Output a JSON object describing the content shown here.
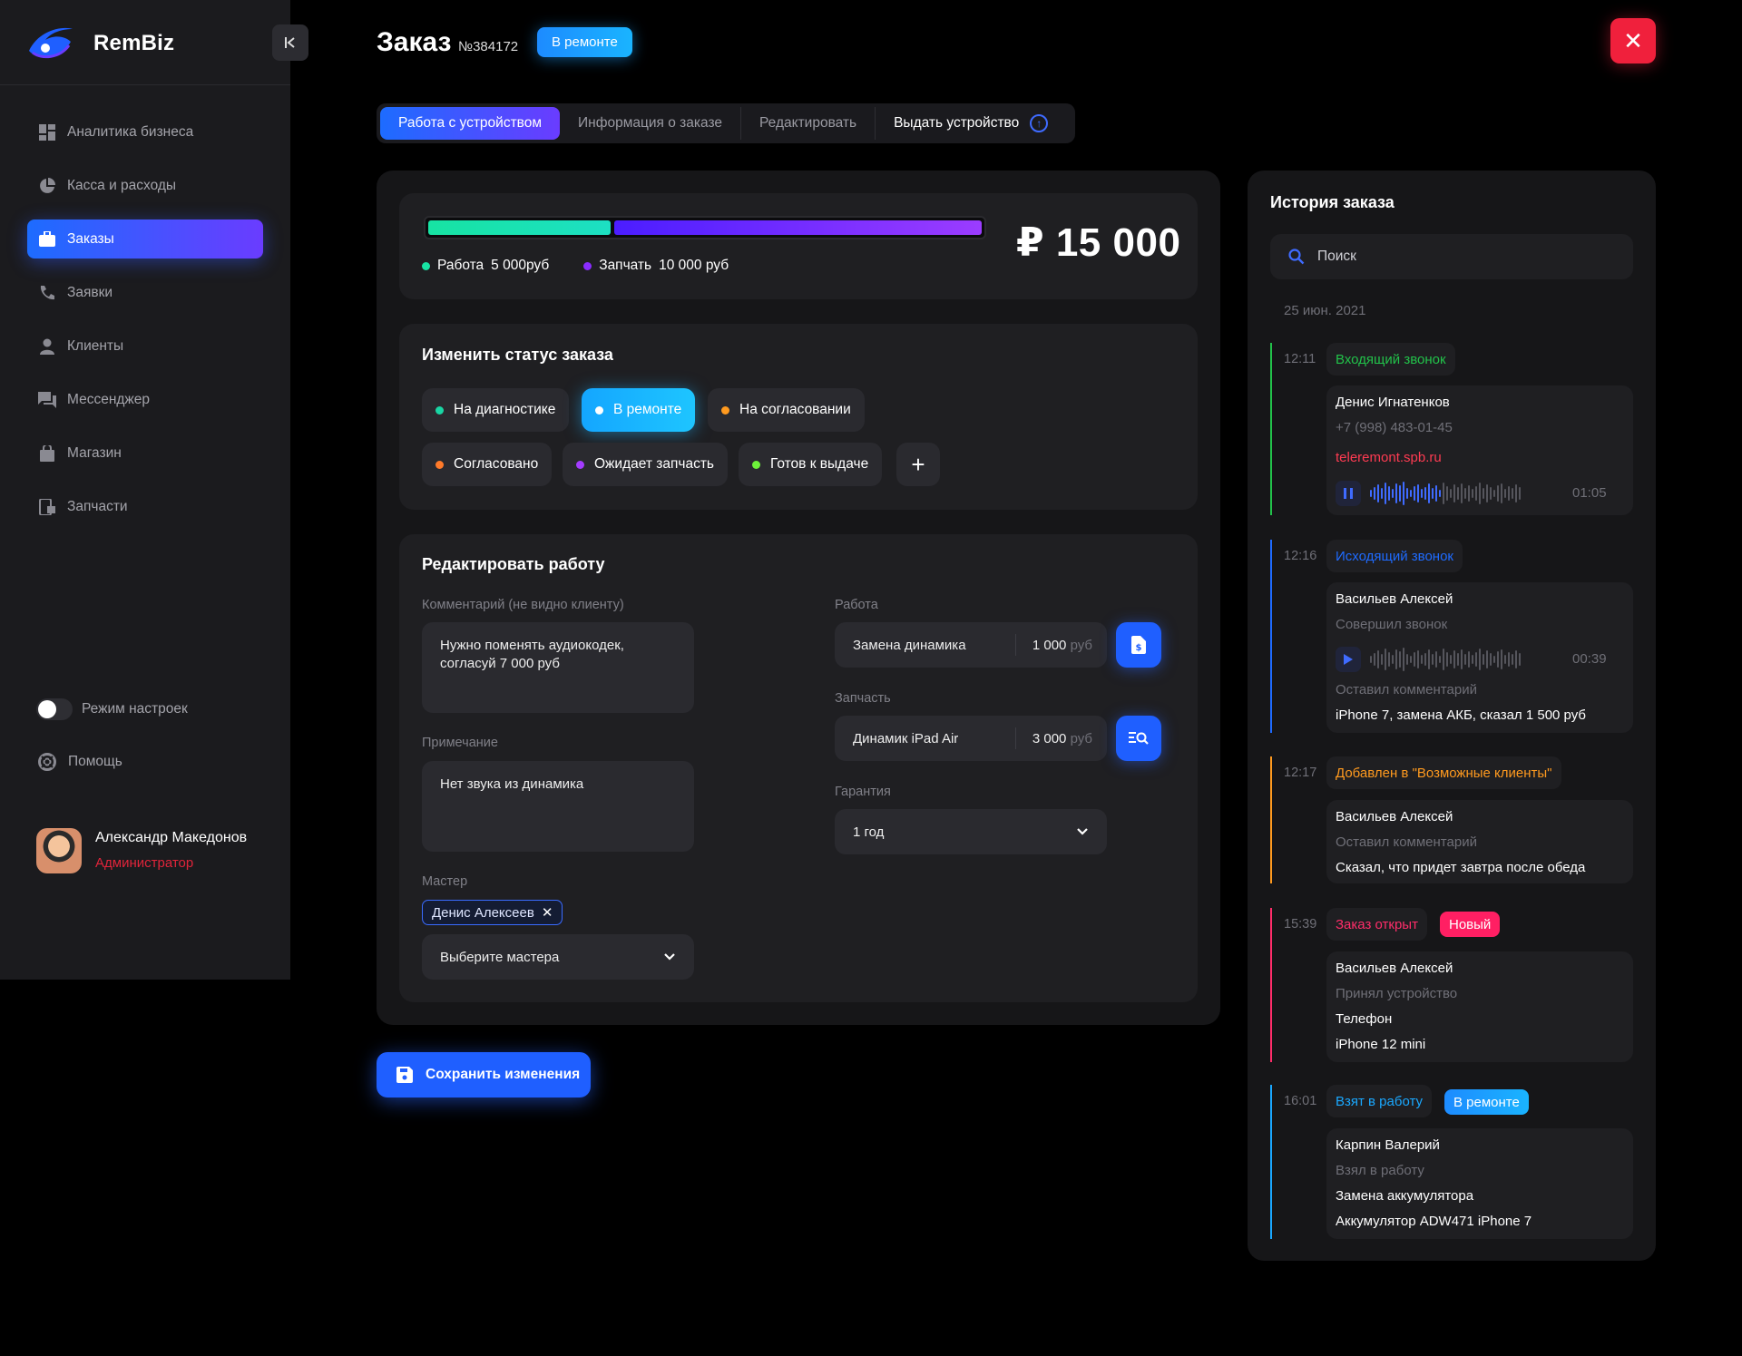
{
  "app": {
    "name": "RemBiz"
  },
  "sidebar": {
    "items": [
      {
        "label": "Аналитика бизнеса",
        "icon": "dashboard-icon",
        "active": false
      },
      {
        "label": "Касса и расходы",
        "icon": "pie-chart-icon",
        "active": false
      },
      {
        "label": "Заказы",
        "icon": "briefcase-icon",
        "active": true
      },
      {
        "label": "Заявки",
        "icon": "phone-icon",
        "active": false
      },
      {
        "label": "Клиенты",
        "icon": "user-icon",
        "active": false
      },
      {
        "label": "Мессенджер",
        "icon": "chat-icon",
        "active": false
      },
      {
        "label": "Магазин",
        "icon": "shopping-bag-icon",
        "active": false
      },
      {
        "label": "Запчасти",
        "icon": "parts-icon",
        "active": false
      }
    ],
    "settings_mode": "Режим настроек",
    "help": "Помощь",
    "user": {
      "name": "Александр Македонов",
      "role": "Администратор"
    }
  },
  "header": {
    "title": "Заказ",
    "number": "№384172",
    "status": "В ремонте"
  },
  "tabs": [
    {
      "label": "Работа с устройством",
      "active": true
    },
    {
      "label": "Информация о заказе",
      "active": false
    },
    {
      "label": "Редактировать",
      "active": false
    },
    {
      "label": "Выдать устройство",
      "active": false
    }
  ],
  "cost": {
    "work_fraction": 0.33,
    "part_fraction": 0.67,
    "work_label": "Работа",
    "work_value": "5 000руб",
    "part_label": "Запчать",
    "part_value": "10 000 руб",
    "total": "₽ 15 000"
  },
  "status_change": {
    "title": "Изменить статус заказа",
    "options": [
      {
        "label": "На диагностике",
        "color": "#19d6a4",
        "active": false
      },
      {
        "label": "В ремонте",
        "color": "#ffffff",
        "active": true
      },
      {
        "label": "На согласовании",
        "color": "#ff9a1f",
        "active": false
      },
      {
        "label": "Согласовано",
        "color": "#ff7a2a",
        "active": false
      },
      {
        "label": "Ожидает запчасть",
        "color": "#a43cff",
        "active": false
      },
      {
        "label": "Готов к выдаче",
        "color": "#6df23a",
        "active": false
      }
    ]
  },
  "edit_work": {
    "title": "Редактировать работу",
    "comment_label": "Комментарий (не видно клиенту)",
    "comment_value": "Нужно поменять аудиокодек, согласуй 7 000 руб",
    "note_label": "Примечание",
    "note_value": "Нет звука из динамика",
    "master_label": "Мастер",
    "master_tag": "Денис Алексеев",
    "master_select": "Выберите мастера",
    "work_label": "Работа",
    "work_name": "Замена динамика",
    "work_price": "1 000",
    "work_currency": "руб",
    "part_label": "Запчасть",
    "part_name": "Динамик iPad Air",
    "part_price": "3 000",
    "part_currency": "руб",
    "warranty_label": "Гарантия",
    "warranty_value": "1 год"
  },
  "save_button": "Сохранить изменения",
  "history": {
    "title": "История заказа",
    "search_placeholder": "Поиск",
    "date": "25 июн. 2021",
    "events": [
      {
        "time": "12:11",
        "title": "Входящий звонок",
        "color": "#22c24a",
        "name": "Денис Игнатенков",
        "phone": "+7 (998) 483-01-45",
        "link": "teleremont.spb.ru",
        "duration": "01:05"
      },
      {
        "time": "12:16",
        "title": "Исходящий звонок",
        "color": "#1f6bff",
        "name": "Васильев Алексей",
        "sub": "Совершил звонок",
        "duration": "00:39",
        "note_label": "Оставил комментарий",
        "note": "iPhone 7, замена АКБ, сказал 1 500 руб"
      },
      {
        "time": "12:17",
        "title": "Добавлен в \"Возможные клиенты\"",
        "color": "#ff9a1f",
        "name": "Васильев Алексей",
        "sub": "Оставил комментарий",
        "note": "Сказал, что придет завтра после обеда"
      },
      {
        "time": "15:39",
        "title": "Заказ открыт",
        "color": "#ff2d6a",
        "badge": "Новый",
        "name": "Васильев Алексей",
        "sub": "Принял устройство",
        "device_type": "Телефон",
        "device": "iPhone 12 mini"
      },
      {
        "time": "16:01",
        "title": "Взят в работу",
        "color": "#1aa8ff",
        "badge": "В ремонте",
        "name": "Карпин Валерий",
        "sub": "Взял в работу",
        "work": "Замена аккумулятора",
        "part": "Аккумулятор ADW471 iPhone 7"
      }
    ]
  }
}
